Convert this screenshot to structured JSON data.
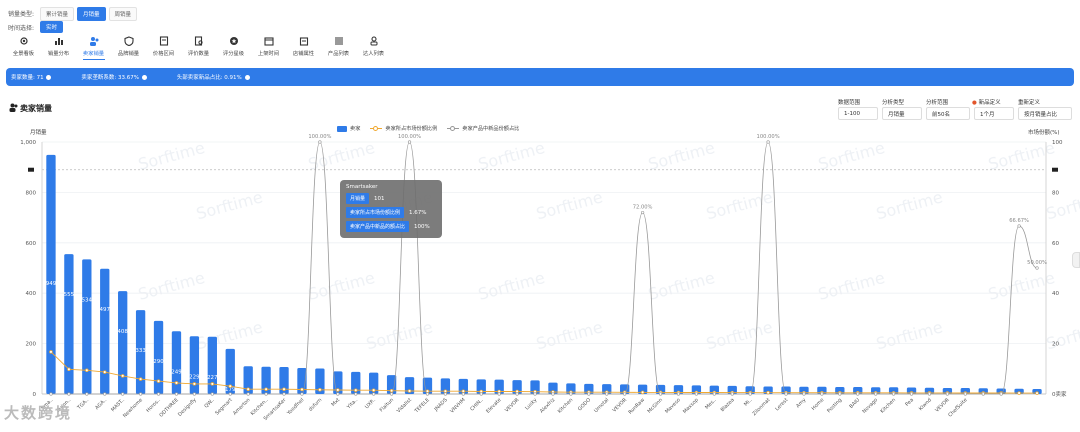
{
  "filters": {
    "sales_type_label": "销量类型:",
    "sales_types": [
      "累计销量",
      "月销量",
      "周销量"
    ],
    "sales_type_active": 1,
    "time_label": "时间选择:",
    "time_button": "实时"
  },
  "nav": [
    {
      "label": "全景看板",
      "icon": "eye-icon"
    },
    {
      "label": "销量分布",
      "icon": "bar-chart-icon"
    },
    {
      "label": "卖家销量",
      "icon": "user-group-icon",
      "active": true
    },
    {
      "label": "品牌销量",
      "icon": "shield-icon"
    },
    {
      "label": "价格区间",
      "icon": "book-icon"
    },
    {
      "label": "评价数量",
      "icon": "file-search-icon"
    },
    {
      "label": "评分星级",
      "icon": "star-icon"
    },
    {
      "label": "上架时间",
      "icon": "calendar-icon"
    },
    {
      "label": "店铺属性",
      "icon": "store-icon"
    },
    {
      "label": "产品列表",
      "icon": "list-icon"
    },
    {
      "label": "达人列表",
      "icon": "person-icon"
    }
  ],
  "summary": {
    "sellers": "卖家数量: 71",
    "concentration": "卖家垄断系数: 33.67%",
    "top_new": "头部卖家新品占比: 0.91%"
  },
  "panel": {
    "title": "卖家销量",
    "controls": {
      "data_range_label": "数据范围",
      "data_range": "1-100",
      "analysis_type_label": "分析类型",
      "analysis_type": "月销量",
      "analysis_scope_label": "分析范围",
      "analysis_scope": "前50名",
      "new_def_label": "新品定义",
      "new_def": "1个月",
      "sort_label": "重新定义",
      "sort": "按月销量占比"
    }
  },
  "tooltip": {
    "name": "Smartsaker",
    "row1_label": "月销量",
    "row1_value": "101",
    "row2_label": "卖家所占市场份额比例",
    "row2_value": "1.67%",
    "row3_label": "卖家产品中新品的额占比",
    "row3_value": "100%"
  },
  "watermark": "大数跨境",
  "chart_data": {
    "type": "bar",
    "legend": [
      "卖家",
      "卖家所占市场份额比例",
      "卖家产品中新品份额占比"
    ],
    "ylabel": "月销量",
    "y2label": "市场份额(%)",
    "ylim": [
      0,
      1000
    ],
    "y2lim": [
      0,
      100
    ],
    "yticks": [
      "0",
      "200",
      "400",
      "600",
      "800",
      "1,000"
    ],
    "y2ticks": [
      "0卖家",
      "20",
      "40",
      "60",
      "80",
      "100"
    ],
    "grid": true,
    "legend_position": "top-center",
    "series": [
      {
        "name": "卖家",
        "values": [
          949,
          555,
          534,
          497,
          408,
          333,
          290,
          249,
          229,
          227,
          179,
          110,
          108,
          107,
          103,
          101,
          90,
          88,
          85,
          75,
          67,
          65,
          62,
          60,
          58,
          57,
          55,
          54,
          45,
          42,
          40,
          39,
          38,
          37,
          36,
          35,
          34,
          33,
          32,
          31,
          30,
          30,
          29,
          29,
          28,
          28,
          27,
          27,
          26,
          25,
          24,
          24,
          23,
          22,
          21,
          20
        ]
      },
      {
        "name": "卖家所占市场份额比例",
        "values": [
          16.7,
          9.8,
          9.4,
          8.7,
          7.2,
          5.9,
          5.1,
          4.4,
          4.0,
          4.0,
          3.1,
          1.9,
          1.9,
          1.9,
          1.8,
          1.67,
          1.6,
          1.5,
          1.5,
          1.3,
          1.2,
          1.1,
          1.1,
          1.1,
          1.0,
          1.0,
          1.0,
          0.9,
          0.8,
          0.7,
          0.7,
          0.7,
          0.67,
          0.65,
          0.63,
          0.6,
          0.6,
          0.6,
          0.56,
          0.55,
          0.53,
          0.52,
          0.51,
          0.5,
          0.49,
          0.48,
          0.47,
          0.46,
          0.45,
          0.44,
          0.42,
          0.41,
          0.4,
          0.39,
          0.37,
          0.35
        ]
      },
      {
        "name": "卖家产品中新品份额占比",
        "values": [
          0,
          0,
          0,
          0,
          0,
          0,
          0,
          0,
          0,
          0,
          0,
          0,
          0,
          0,
          0,
          100,
          0,
          0,
          0,
          0,
          100,
          0,
          0,
          0,
          0,
          0,
          0,
          0,
          0,
          0,
          0,
          0,
          0,
          72,
          0,
          0,
          0,
          0,
          0,
          0,
          100,
          0,
          0,
          0,
          0,
          0,
          0,
          0,
          0,
          0,
          0,
          0,
          0,
          0,
          66.67,
          50
        ]
      }
    ],
    "point_labels": [
      "100.00%",
      "100.00%",
      "72.00%",
      "100.00%",
      "66.67%",
      "50.00%"
    ],
    "categories": [
      "Sma..",
      "Terinn..",
      "TGA..",
      "AGA..",
      "MAST..",
      "Newhome",
      "Horos..",
      "ODTHREE",
      "Designfly",
      "QW..",
      "Segmart",
      "Amerton",
      "Kitchen..",
      "SmartsaKer",
      "Yoodfnel",
      "dsfurn",
      "Mxt",
      "Yita..",
      "UXP..",
      "Flaitun",
      "Vidalist",
      "TEFELE",
      "JNADS",
      "VNVHM",
      "CHIN..",
      "Elevate",
      "VEVOR",
      "Lusky",
      "Alexfriz",
      "Kitchen",
      "GODO",
      "Umotal",
      "VEVOR",
      "RunRaw",
      "McGinn",
      "Maveso",
      "Maxsop",
      "Mes..",
      "Blazea",
      "Mi..",
      "Zilonmat",
      "Lerest",
      "Amy",
      "Home",
      "Posting",
      "BAIU",
      "Novago",
      "Kitchen",
      "Pea",
      "Kiwnd",
      "VEVOR",
      "ChefSuite"
    ]
  }
}
